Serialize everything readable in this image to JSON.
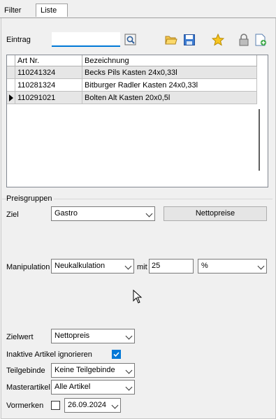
{
  "tabs": [
    {
      "label": "Filter",
      "active": false
    },
    {
      "label": "Liste",
      "active": true
    }
  ],
  "eintrag": {
    "label": "Eintrag",
    "value": ""
  },
  "toolbar_icons": [
    "search-icon",
    "open-folder-icon",
    "save-icon",
    "star-icon",
    "lock-icon",
    "add-document-icon"
  ],
  "grid": {
    "columns": [
      "Art Nr.",
      "Bezeichnung"
    ],
    "rows": [
      {
        "art_nr": "110241324",
        "bezeichnung": "Becks Pils Kasten 24x0,33l",
        "current": false
      },
      {
        "art_nr": "110281324",
        "bezeichnung": "Bitburger Radler Kasten 24x0,33l",
        "current": false
      },
      {
        "art_nr": "110291021",
        "bezeichnung": "Bolten Alt Kasten 20x0,5l",
        "current": true
      }
    ]
  },
  "preisgruppen": {
    "title": "Preisgruppen",
    "ziel_label": "Ziel",
    "ziel_value": "Gastro",
    "nettopreise_label": "Nettopreise"
  },
  "manipulation": {
    "label": "Manipulation",
    "method": "Neukalkulation",
    "mit_label": "mit",
    "amount": "25",
    "unit": "%"
  },
  "zielwert": {
    "label": "Zielwert",
    "value": "Nettopreis"
  },
  "inaktive": {
    "label": "Inaktive Artikel ignorieren",
    "checked": true
  },
  "teilgebinde": {
    "label": "Teilgebinde",
    "value": "Keine Teilgebinde"
  },
  "masterartikel": {
    "label": "Masterartikel",
    "value": "Alle Artikel"
  },
  "vormerken": {
    "label": "Vormerken",
    "checked": false,
    "date": "26.09.2024"
  },
  "colors": {
    "accent": "#0078d7",
    "row_highlight": "#e6e6e6"
  }
}
